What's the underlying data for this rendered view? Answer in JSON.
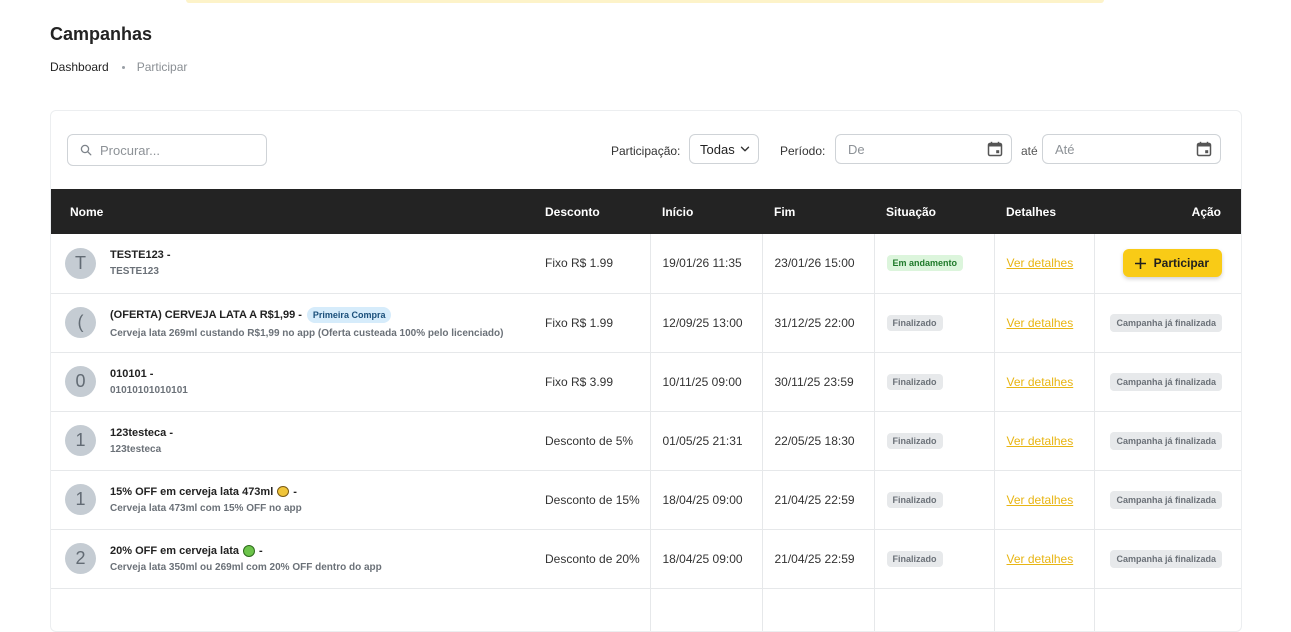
{
  "page": {
    "title": "Campanhas",
    "breadcrumb": {
      "home": "Dashboard",
      "current": "Participar"
    }
  },
  "filters": {
    "search_placeholder": "Procurar...",
    "participation_label": "Participação:",
    "participation_value": "Todas",
    "period_label": "Período:",
    "from_placeholder": "De",
    "to_separator": "até",
    "to_placeholder": "Até"
  },
  "table": {
    "headers": {
      "nome": "Nome",
      "desconto": "Desconto",
      "inicio": "Início",
      "fim": "Fim",
      "situacao": "Situação",
      "detalhes": "Detalhes",
      "acao": "Ação"
    },
    "details_link_label": "Ver detalhes",
    "participate_label": "Participar",
    "ended_label": "Campanha já finalizada",
    "rows": [
      {
        "initial": "T",
        "title": "TESTE123 -",
        "subtitle": "TESTE123",
        "discount": "Fixo R$ 1.99",
        "start": "19/01/26 11:35",
        "end": "23/01/26 15:00",
        "status": "Em andamento"
      },
      {
        "initial": "(",
        "title": "(OFERTA) CERVEJA LATA A R$1,99 -",
        "badge": "Primeira Compra",
        "subtitle": "Cerveja lata 269ml custando R$1,99 no app (Oferta custeada 100% pelo licenciado)",
        "discount": "Fixo R$ 1.99",
        "start": "12/09/25 13:00",
        "end": "31/12/25 22:00",
        "status": "Finalizado"
      },
      {
        "initial": "0",
        "title": "010101 -",
        "subtitle": "01010101010101",
        "discount": "Fixo R$ 3.99",
        "start": "10/11/25 09:00",
        "end": "30/11/25 23:59",
        "status": "Finalizado"
      },
      {
        "initial": "1",
        "title": "123testeca -",
        "subtitle": "123testeca",
        "discount": "Desconto de 5%",
        "start": "01/05/25 21:31",
        "end": "22/05/25 18:30",
        "status": "Finalizado"
      },
      {
        "initial": "1",
        "title_before": "15% OFF em cerveja lata 473ml",
        "title_after": "-",
        "subtitle": "Cerveja lata 473ml com 15% OFF no app",
        "discount": "Desconto de 15%",
        "start": "18/04/25 09:00",
        "end": "21/04/25 22:59",
        "status": "Finalizado"
      },
      {
        "initial": "2",
        "title_before": "20% OFF em cerveja lata",
        "title_after": "-",
        "subtitle": "Cerveja lata 350ml ou 269ml com 20% OFF dentro do app",
        "discount": "Desconto de 20%",
        "start": "18/04/25 09:00",
        "end": "21/04/25 22:59",
        "status": "Finalizado"
      }
    ]
  },
  "colors": {
    "accent": "#f9cb16",
    "header_bg": "#232323",
    "status_active_bg": "#dcf5dc",
    "status_active_text": "#1f7a2a",
    "status_done_bg": "#e7e9eb"
  },
  "icons": {
    "search": "search-icon",
    "dropdown": "chevron-down-icon",
    "calendar": "calendar-icon",
    "plus": "plus-icon",
    "beer_emoji": "beer-can-emoji-icon",
    "money_emoji": "money-face-emoji-icon"
  }
}
